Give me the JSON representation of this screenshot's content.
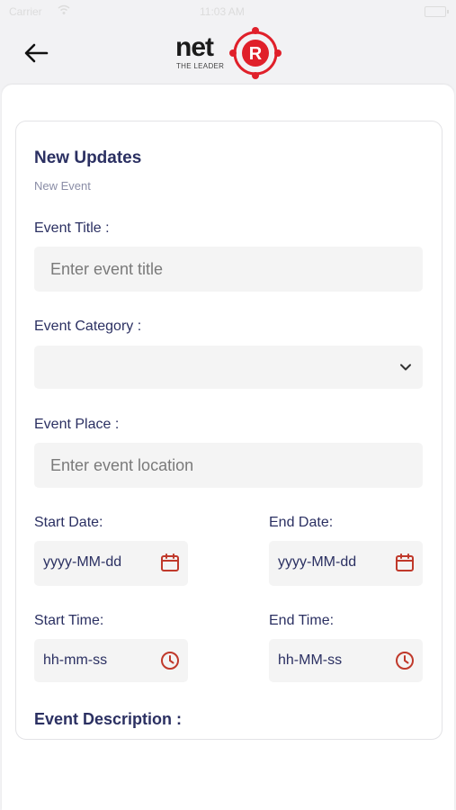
{
  "status_bar": {
    "carrier": "Carrier",
    "time": "11:03 AM"
  },
  "header": {
    "back_icon": "arrow-left-icon",
    "logo_text": "net",
    "logo_mark": "R",
    "logo_tagline": "THE LEADER"
  },
  "form": {
    "title": "New Updates",
    "subtitle": "New Event",
    "event_title": {
      "label": "Event Title :",
      "placeholder": "Enter event title",
      "value": ""
    },
    "event_category": {
      "label": "Event Category :",
      "value": ""
    },
    "event_place": {
      "label": "Event Place :",
      "placeholder": "Enter event location",
      "value": ""
    },
    "start_date": {
      "label": "Start Date:",
      "value": "yyyy-MM-dd",
      "icon": "calendar-icon"
    },
    "end_date": {
      "label": "End Date:",
      "value": "yyyy-MM-dd",
      "icon": "calendar-icon"
    },
    "start_time": {
      "label": "Start Time:",
      "value": "hh-mm-ss",
      "icon": "clock-icon"
    },
    "end_time": {
      "label": "End Time:",
      "value": "hh-MM-ss",
      "icon": "clock-icon"
    },
    "description_heading": "Event Description :"
  },
  "colors": {
    "accent": "#c0392b",
    "text": "#2b3062",
    "field_bg": "#f4f4f4",
    "logo_red": "#e0202a"
  }
}
